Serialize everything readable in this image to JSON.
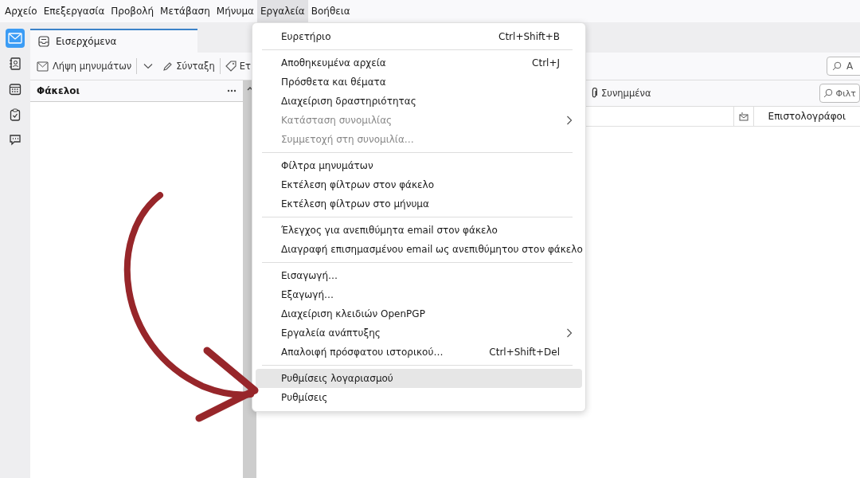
{
  "menu_bar": [
    {
      "label": "Αρχείο",
      "selected": false
    },
    {
      "label": "Επεξεργασία",
      "selected": false
    },
    {
      "label": "Προβολή",
      "selected": false
    },
    {
      "label": "Μετάβαση",
      "selected": false
    },
    {
      "label": "Μήνυμα",
      "selected": false
    },
    {
      "label": "Εργαλεία",
      "selected": true
    },
    {
      "label": "Βοήθεια",
      "selected": false
    }
  ],
  "spaces": [
    {
      "kind": "mail",
      "selected": true
    },
    {
      "kind": "contacts",
      "selected": false
    },
    {
      "kind": "calendar",
      "selected": false
    },
    {
      "kind": "tasks",
      "selected": false
    },
    {
      "kind": "chat",
      "selected": false
    }
  ],
  "tab": {
    "title": "Εισερχόμενα"
  },
  "toolbar": {
    "get_messages": "Λήψη μηνυμάτων",
    "compose": "Σύνταξη",
    "tag": "Ετ",
    "search": "Α"
  },
  "folder_pane": {
    "title": "Φάκελοι"
  },
  "quick_filter": {
    "attachments": "Συνημμένα",
    "filter": "Φιλτ"
  },
  "columns": [
    "Επιστολογράφοι"
  ],
  "tools_menu": [
    [
      {
        "label": "Ευρετήριο",
        "shortcut": "Ctrl+Shift+B",
        "disabled": false,
        "submenu": false,
        "selected": false
      }
    ],
    [
      {
        "label": "Αποθηκευμένα αρχεία",
        "shortcut": "Ctrl+J",
        "disabled": false,
        "submenu": false,
        "selected": false
      },
      {
        "label": "Πρόσθετα και θέματα",
        "disabled": false,
        "submenu": false,
        "selected": false
      },
      {
        "label": "Διαχείριση δραστηριότητας",
        "disabled": false,
        "submenu": false,
        "selected": false
      },
      {
        "label": "Κατάσταση συνομιλίας",
        "disabled": true,
        "submenu": true,
        "selected": false
      },
      {
        "label": "Συμμετοχή στη συνομιλία…",
        "disabled": true,
        "submenu": false,
        "selected": false
      }
    ],
    [
      {
        "label": "Φίλτρα μηνυμάτων",
        "disabled": false,
        "submenu": false,
        "selected": false
      },
      {
        "label": "Εκτέλεση φίλτρων στον φάκελο",
        "disabled": false,
        "submenu": false,
        "selected": false
      },
      {
        "label": "Εκτέλεση φίλτρων στο μήνυμα",
        "disabled": false,
        "submenu": false,
        "selected": false
      }
    ],
    [
      {
        "label": "Έλεγχος για ανεπιθύμητα email στον φάκελο",
        "disabled": false,
        "submenu": false,
        "selected": false
      },
      {
        "label": "Διαγραφή επισημασμένου email ως ανεπιθύμητου στον φάκελο",
        "disabled": false,
        "submenu": false,
        "selected": false
      }
    ],
    [
      {
        "label": "Εισαγωγή…",
        "disabled": false,
        "submenu": false,
        "selected": false
      },
      {
        "label": "Εξαγωγή…",
        "disabled": false,
        "submenu": false,
        "selected": false
      },
      {
        "label": "Διαχείριση κλειδιών OpenPGP",
        "disabled": false,
        "submenu": false,
        "selected": false
      },
      {
        "label": "Εργαλεία ανάπτυξης",
        "disabled": false,
        "submenu": true,
        "selected": false
      },
      {
        "label": "Απαλοιφή πρόσφατου ιστορικού…",
        "shortcut": "Ctrl+Shift+Del",
        "disabled": false,
        "submenu": false,
        "selected": false
      }
    ],
    [
      {
        "label": "Ρυθμίσεις λογαριασμού",
        "disabled": false,
        "submenu": false,
        "selected": true
      },
      {
        "label": "Ρυθμίσεις",
        "disabled": false,
        "submenu": false,
        "selected": false
      }
    ]
  ]
}
